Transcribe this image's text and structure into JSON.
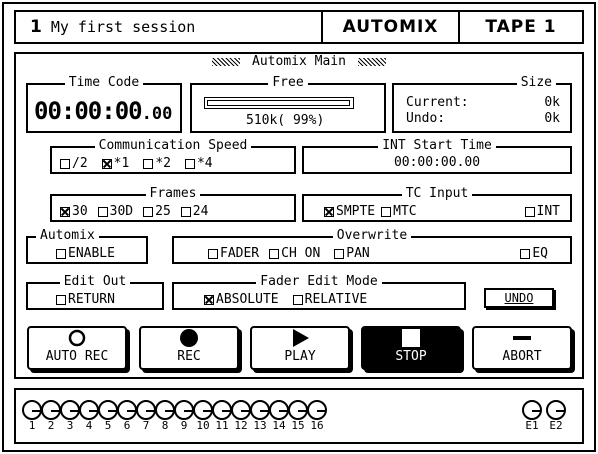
{
  "header": {
    "session_number": "1",
    "session_name": "My first session",
    "mode": "AUTOMIX",
    "source": "TAPE 1"
  },
  "main": {
    "title": "Automix Main",
    "time_code": {
      "legend": "Time Code",
      "value": "00:00:00",
      "frames": "00"
    },
    "free": {
      "legend": "Free",
      "value": "510k( 99%)",
      "level": 0.99
    },
    "size": {
      "legend": "Size",
      "current_label": "Current:",
      "current_value": "0k",
      "undo_label": "Undo:",
      "undo_value": "0k"
    },
    "comm_speed": {
      "legend": "Communication Speed",
      "options": [
        {
          "label": "/2",
          "checked": false
        },
        {
          "label": "*1",
          "checked": true
        },
        {
          "label": "*2",
          "checked": false
        },
        {
          "label": "*4",
          "checked": false
        }
      ]
    },
    "int_start": {
      "legend": "INT Start Time",
      "value": "00:00:00.00"
    },
    "frames": {
      "legend": "Frames",
      "options": [
        {
          "label": "30",
          "checked": true
        },
        {
          "label": "30D",
          "checked": false
        },
        {
          "label": "25",
          "checked": false
        },
        {
          "label": "24",
          "checked": false
        }
      ]
    },
    "tc_input": {
      "legend": "TC Input",
      "options": [
        {
          "label": "SMPTE",
          "checked": true
        },
        {
          "label": "MTC",
          "checked": false
        },
        {
          "label": "INT",
          "checked": false
        }
      ]
    },
    "automix": {
      "legend": "Automix",
      "enable_label": "ENABLE",
      "enable_checked": false
    },
    "overwrite": {
      "legend": "Overwrite",
      "options": [
        {
          "label": "FADER",
          "checked": false
        },
        {
          "label": "CH ON",
          "checked": false
        },
        {
          "label": "PAN",
          "checked": false
        },
        {
          "label": "EQ",
          "checked": false
        }
      ]
    },
    "edit_out": {
      "legend": "Edit Out",
      "return_label": "RETURN",
      "return_checked": false
    },
    "fader_mode": {
      "legend": "Fader Edit Mode",
      "options": [
        {
          "label": "ABSOLUTE",
          "checked": true
        },
        {
          "label": "RELATIVE",
          "checked": false
        }
      ]
    },
    "undo_label": "UNDO"
  },
  "transport": {
    "auto_rec": "AUTO REC",
    "rec": "REC",
    "play": "PLAY",
    "stop": "STOP",
    "abort": "ABORT",
    "active": "stop"
  },
  "channels": [
    "1",
    "2",
    "3",
    "4",
    "5",
    "6",
    "7",
    "8",
    "9",
    "10",
    "11",
    "12",
    "13",
    "14",
    "15",
    "16",
    "E1",
    "E2"
  ]
}
